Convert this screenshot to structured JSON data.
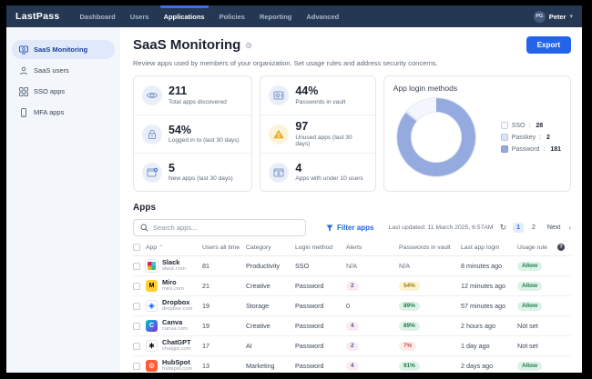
{
  "nav": {
    "brand": "LastPass",
    "items": [
      {
        "label": "Dashboard",
        "active": false
      },
      {
        "label": "Users",
        "active": false
      },
      {
        "label": "Applications",
        "active": true
      },
      {
        "label": "Policies",
        "active": false
      },
      {
        "label": "Reporting",
        "active": false
      },
      {
        "label": "Advanced",
        "active": false
      }
    ],
    "user": {
      "initials": "PG",
      "name": "Peter"
    }
  },
  "sidebar": {
    "items": [
      {
        "label": "SaaS Monitoring",
        "icon": "monitor-search-icon",
        "active": true
      },
      {
        "label": "SaaS users",
        "icon": "user-icon",
        "active": false
      },
      {
        "label": "SSO apps",
        "icon": "grid-icon",
        "active": false
      },
      {
        "label": "MFA apps",
        "icon": "mobile-icon",
        "active": false
      }
    ]
  },
  "header": {
    "title": "SaaS Monitoring",
    "subtitle": "Review apps used by members of your organization. Set usage rules and address security concerns.",
    "export_label": "Export"
  },
  "stats": {
    "left": [
      {
        "icon": "eye-icon",
        "value": "211",
        "label": "Total apps discovered"
      },
      {
        "icon": "lock-icon",
        "value": "54%",
        "label": "Logged in to (last 30 days)"
      },
      {
        "icon": "new-app-icon",
        "value": "5",
        "label": "New apps (last 30 days)"
      }
    ],
    "right": [
      {
        "icon": "vault-icon",
        "value": "44%",
        "label": "Passwords in vault"
      },
      {
        "icon": "warning-icon",
        "value": "97",
        "label": "Unused apps (last 30 days)"
      },
      {
        "icon": "app-users-icon",
        "value": "4",
        "label": "Apps with under 10 users"
      }
    ]
  },
  "chart_data": {
    "type": "pie",
    "donut": true,
    "title": "App login methods",
    "categories": [
      "SSO",
      "Passkey",
      "Password"
    ],
    "values": [
      28,
      2,
      181
    ],
    "colors": [
      "#f3f6fc",
      "#dce3f6",
      "#95abdf"
    ],
    "legend_position": "right",
    "draw_order_clockwise_from_top": [
      "Password",
      "Passkey",
      "SSO"
    ]
  },
  "apps": {
    "heading": "Apps",
    "search_placeholder": "Search apps...",
    "filter_label": "Filter apps",
    "last_updated": "Last updated: 11 March 2025, 6:57AM",
    "pagination": {
      "page1": "1",
      "page2": "2",
      "next_label": "Next",
      "next_chevron": "›"
    },
    "columns": [
      "App",
      "Users all time",
      "Category",
      "Login method",
      "Alerts",
      "Passwords in vault",
      "Last app login",
      "Usage rule"
    ],
    "rows": [
      {
        "name": "Slack",
        "domain": "slack.com",
        "users": "81",
        "category": "Productivity",
        "login": "SSO",
        "alerts": "N/A",
        "vault": "N/A",
        "last_login": "8 minutes ago",
        "usage": "Allow"
      },
      {
        "name": "Miro",
        "domain": "miro.com",
        "users": "21",
        "category": "Creative",
        "login": "Password",
        "alerts": "2",
        "vault": "54%",
        "last_login": "12 minutes ago",
        "usage": "Allow"
      },
      {
        "name": "Dropbox",
        "domain": "dropbox.com",
        "users": "19",
        "category": "Storage",
        "login": "Password",
        "alerts": "0",
        "vault": "89%",
        "last_login": "57 minutes ago",
        "usage": "Allow"
      },
      {
        "name": "Canva",
        "domain": "canva.com",
        "users": "19",
        "category": "Creative",
        "login": "Password",
        "alerts": "4",
        "vault": "89%",
        "last_login": "2 hours ago",
        "usage": "Not set"
      },
      {
        "name": "ChatGPT",
        "domain": "chatgpt.com",
        "users": "17",
        "category": "AI",
        "login": "Password",
        "alerts": "2",
        "vault": "7%",
        "last_login": "1 day ago",
        "usage": "Not set"
      },
      {
        "name": "HubSpot",
        "domain": "hubspot.com",
        "users": "13",
        "category": "Marketing",
        "login": "Password",
        "alerts": "4",
        "vault": "91%",
        "last_login": "2 days ago",
        "usage": "Allow"
      }
    ]
  },
  "colors": {
    "nav_bg": "#253853",
    "accent_blue": "#2563eb",
    "active_indicator": "#3d6fe8",
    "sidebar_bg": "#f3f6fa",
    "sidebar_active_bg": "#dfe9fa",
    "badge_green_bg": "#ddf2e6",
    "badge_green_text": "#1e7b4f",
    "badge_yellow_bg": "#fcf3cf",
    "badge_yellow_text": "#9a7b1d",
    "badge_red_bg": "#fdeaea",
    "badge_red_text": "#d5504c",
    "badge_pink_bg": "#faeaf2",
    "badge_pink_text": "#4c5a93"
  }
}
